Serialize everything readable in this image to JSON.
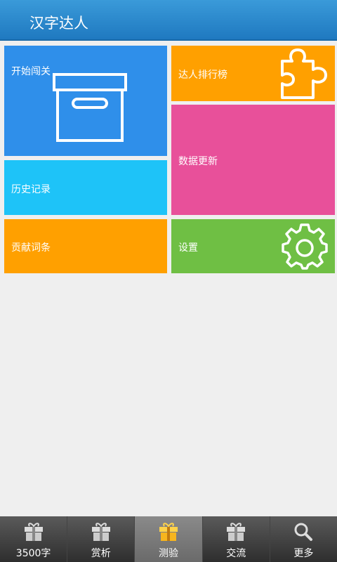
{
  "header": {
    "title": "汉字达人"
  },
  "tiles": {
    "start": {
      "label": "开始闯关",
      "icon": "box-icon",
      "color": "#2f8fea"
    },
    "rank": {
      "label": "达人排行榜",
      "icon": "puzzle-icon",
      "color": "#ffa000"
    },
    "data_update": {
      "label": "数据更新",
      "color": "#e8509a"
    },
    "history": {
      "label": "历史记录",
      "color": "#1ec3f8"
    },
    "contribute": {
      "label": "贡献词条",
      "color": "#ffa000"
    },
    "settings": {
      "label": "设置",
      "icon": "gear-icon",
      "color": "#6fbf44"
    }
  },
  "bottom_nav": {
    "tabs": [
      {
        "label": "3500字",
        "icon": "gift-icon",
        "active": false
      },
      {
        "label": "赏析",
        "icon": "gift-icon",
        "active": false
      },
      {
        "label": "测验",
        "icon": "gift-icon",
        "active": true
      },
      {
        "label": "交流",
        "icon": "gift-icon",
        "active": false
      },
      {
        "label": "更多",
        "icon": "search-icon",
        "active": false
      }
    ]
  }
}
